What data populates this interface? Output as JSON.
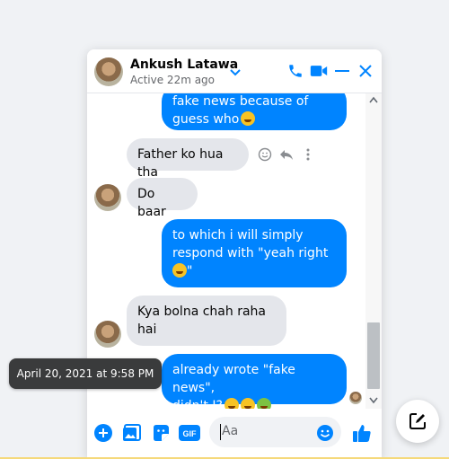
{
  "header": {
    "name": "Ankush Latawa",
    "status": "Active 22m ago"
  },
  "messages": [
    {
      "dir": "out",
      "text": "fake news because of guess who"
    },
    {
      "dir": "in",
      "text": "Father ko hua tha"
    },
    {
      "dir": "in",
      "text": "Do baar"
    },
    {
      "dir": "out",
      "text_lines": [
        "to which i will simply",
        "respond with \"yeah right",
        "\""
      ]
    },
    {
      "dir": "in",
      "text_lines": [
        "Kya bolna chah raha",
        "hai"
      ]
    },
    {
      "dir": "out",
      "text_lines": [
        "already wrote \"fake news\",",
        "didn't I?"
      ]
    }
  ],
  "composer": {
    "placeholder": "Aa",
    "gif_label": "GIF"
  },
  "tooltip": "April 20, 2021 at 9:58 PM",
  "colors": {
    "accent": "#0084ff",
    "incoming": "#e4e6eb",
    "tooltip_bg": "#3a3b3c"
  }
}
